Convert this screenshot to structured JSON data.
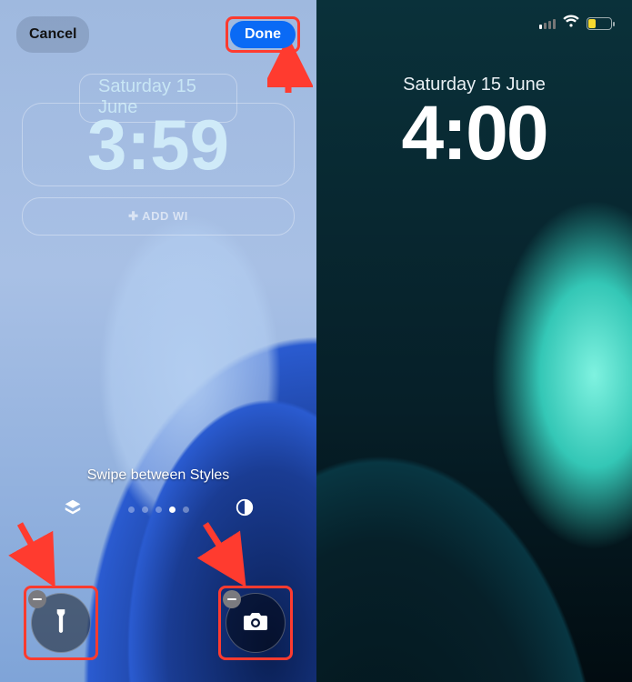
{
  "left": {
    "cancel_label": "Cancel",
    "done_label": "Done",
    "date_text": "Saturday 15 June",
    "clock_text": "3:59",
    "add_widget_label": "✚ ADD WI",
    "swipe_label": "Swipe between Styles",
    "page_dots_active_index": 3,
    "page_dots_total": 5,
    "quick_actions": {
      "left_icon": "flashlight-icon",
      "right_icon": "camera-icon"
    },
    "annotation_color": "#ff3b2f"
  },
  "right": {
    "date_text": "Saturday 15 June",
    "clock_text": "4:00",
    "battery_percent": 32
  }
}
